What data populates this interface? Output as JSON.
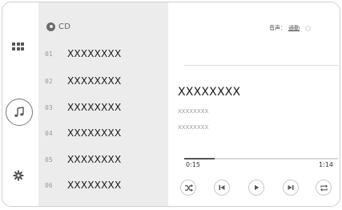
{
  "nav": {
    "items": [
      {
        "icon": "apps-grid-icon"
      },
      {
        "icon": "music-note-icon",
        "selected": true
      },
      {
        "icon": "gear-icon"
      }
    ]
  },
  "source": {
    "icon": "disc-icon",
    "label": "CD"
  },
  "tracks": [
    {
      "number": "01",
      "title": "XXXXXXXX"
    },
    {
      "number": "02",
      "title": "XXXXXXXX"
    },
    {
      "number": "03",
      "title": "XXXXXXXX"
    },
    {
      "number": "04",
      "title": "XXXXXXXX"
    },
    {
      "number": "05",
      "title": "XXXXXXXX"
    },
    {
      "number": "06",
      "title": "XXXXXXXX"
    }
  ],
  "sound": {
    "label": "音声：",
    "value": "通動"
  },
  "now_playing": {
    "title": "XXXXXXXX",
    "artist": "XXXXXXXX",
    "album": "XXXXXXXX",
    "elapsed": "0:15",
    "total": "1:14",
    "progress_fraction": 0.2
  },
  "controls": [
    {
      "icon": "shuffle-icon"
    },
    {
      "icon": "previous-track-icon"
    },
    {
      "icon": "play-icon"
    },
    {
      "icon": "next-track-icon"
    },
    {
      "icon": "repeat-icon"
    }
  ],
  "colors": {
    "list_background": "#ececec",
    "icon": "#555555",
    "accent_text": "#1a1a1a"
  }
}
